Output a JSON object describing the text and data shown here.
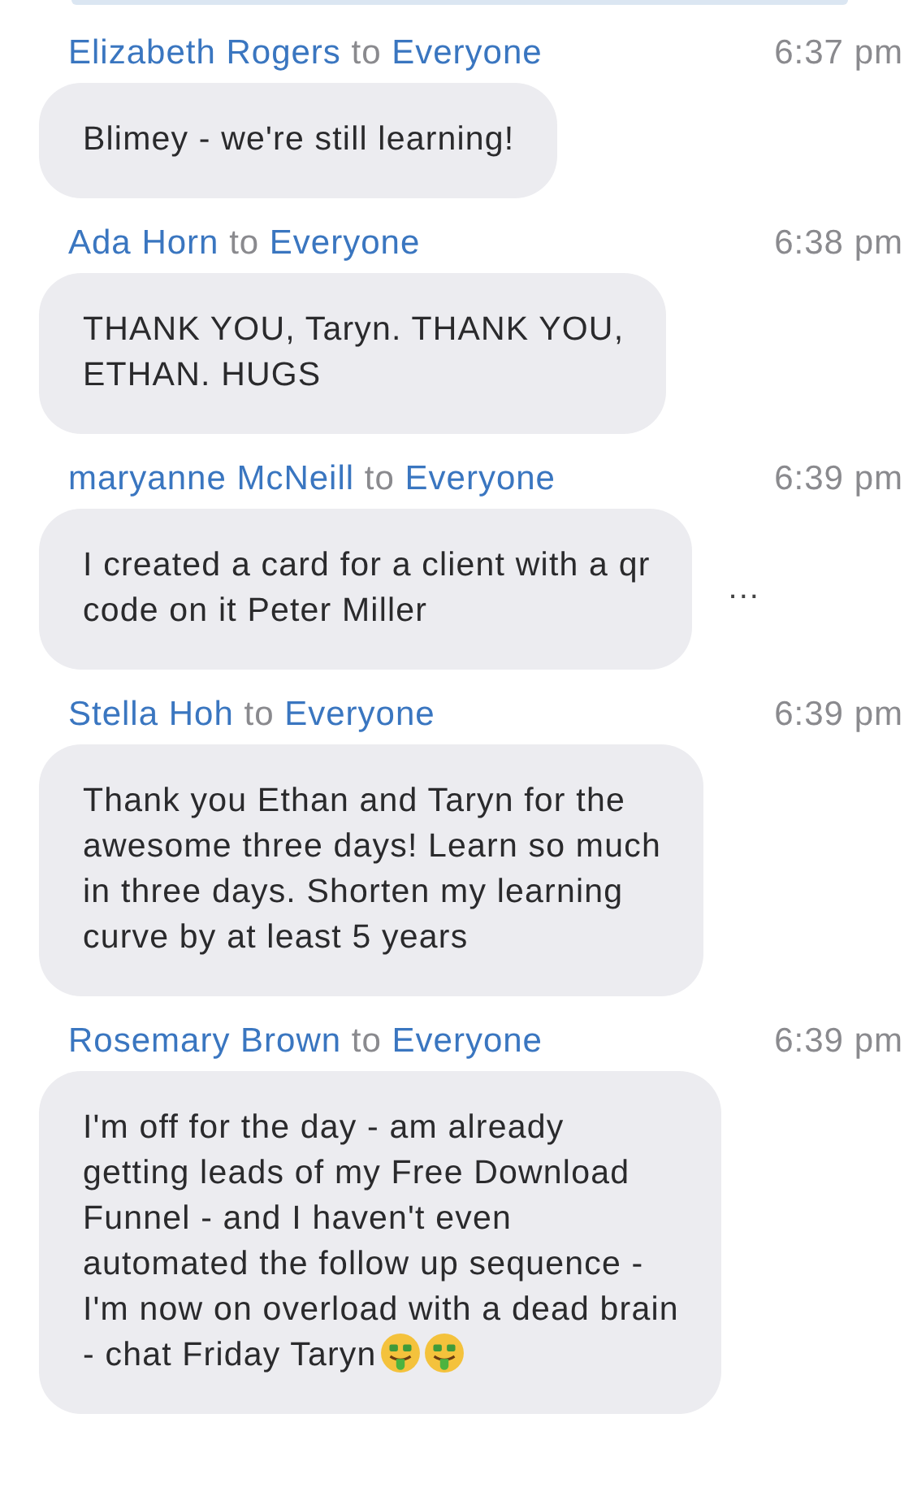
{
  "messages": [
    {
      "sender": "Elizabeth Rogers",
      "to_word": "to",
      "recipient": "Everyone",
      "time": "6:37 pm",
      "text": "Blimey - we're still learning!"
    },
    {
      "sender": "Ada Horn",
      "to_word": "to",
      "recipient": "Everyone",
      "time": "6:38 pm",
      "text": "THANK YOU, Taryn. THANK YOU,\nETHAN. HUGS"
    },
    {
      "sender": "maryanne McNeill",
      "to_word": "to",
      "recipient": "Everyone",
      "time": "6:39 pm",
      "text": "I created a card for a client with a qr\ncode on it Peter Miller",
      "more_label": "..."
    },
    {
      "sender": "Stella Hoh",
      "to_word": "to",
      "recipient": "Everyone",
      "time": "6:39 pm",
      "text": "Thank you Ethan and Taryn for the\nawesome three days! Learn so much\nin three days. Shorten my learning\ncurve by at least 5 years"
    },
    {
      "sender": "Rosemary Brown",
      "to_word": "to",
      "recipient": "Everyone",
      "time": "6:39 pm",
      "text": "I'm off for the day - am already\ngetting leads of my Free Download\nFunnel - and I haven't even\nautomated the follow up sequence -\nI'm now on overload with a dead brain\n- chat Friday Taryn",
      "emojis": [
        {
          "kind": "money-face"
        },
        {
          "kind": "money-face"
        }
      ]
    }
  ]
}
